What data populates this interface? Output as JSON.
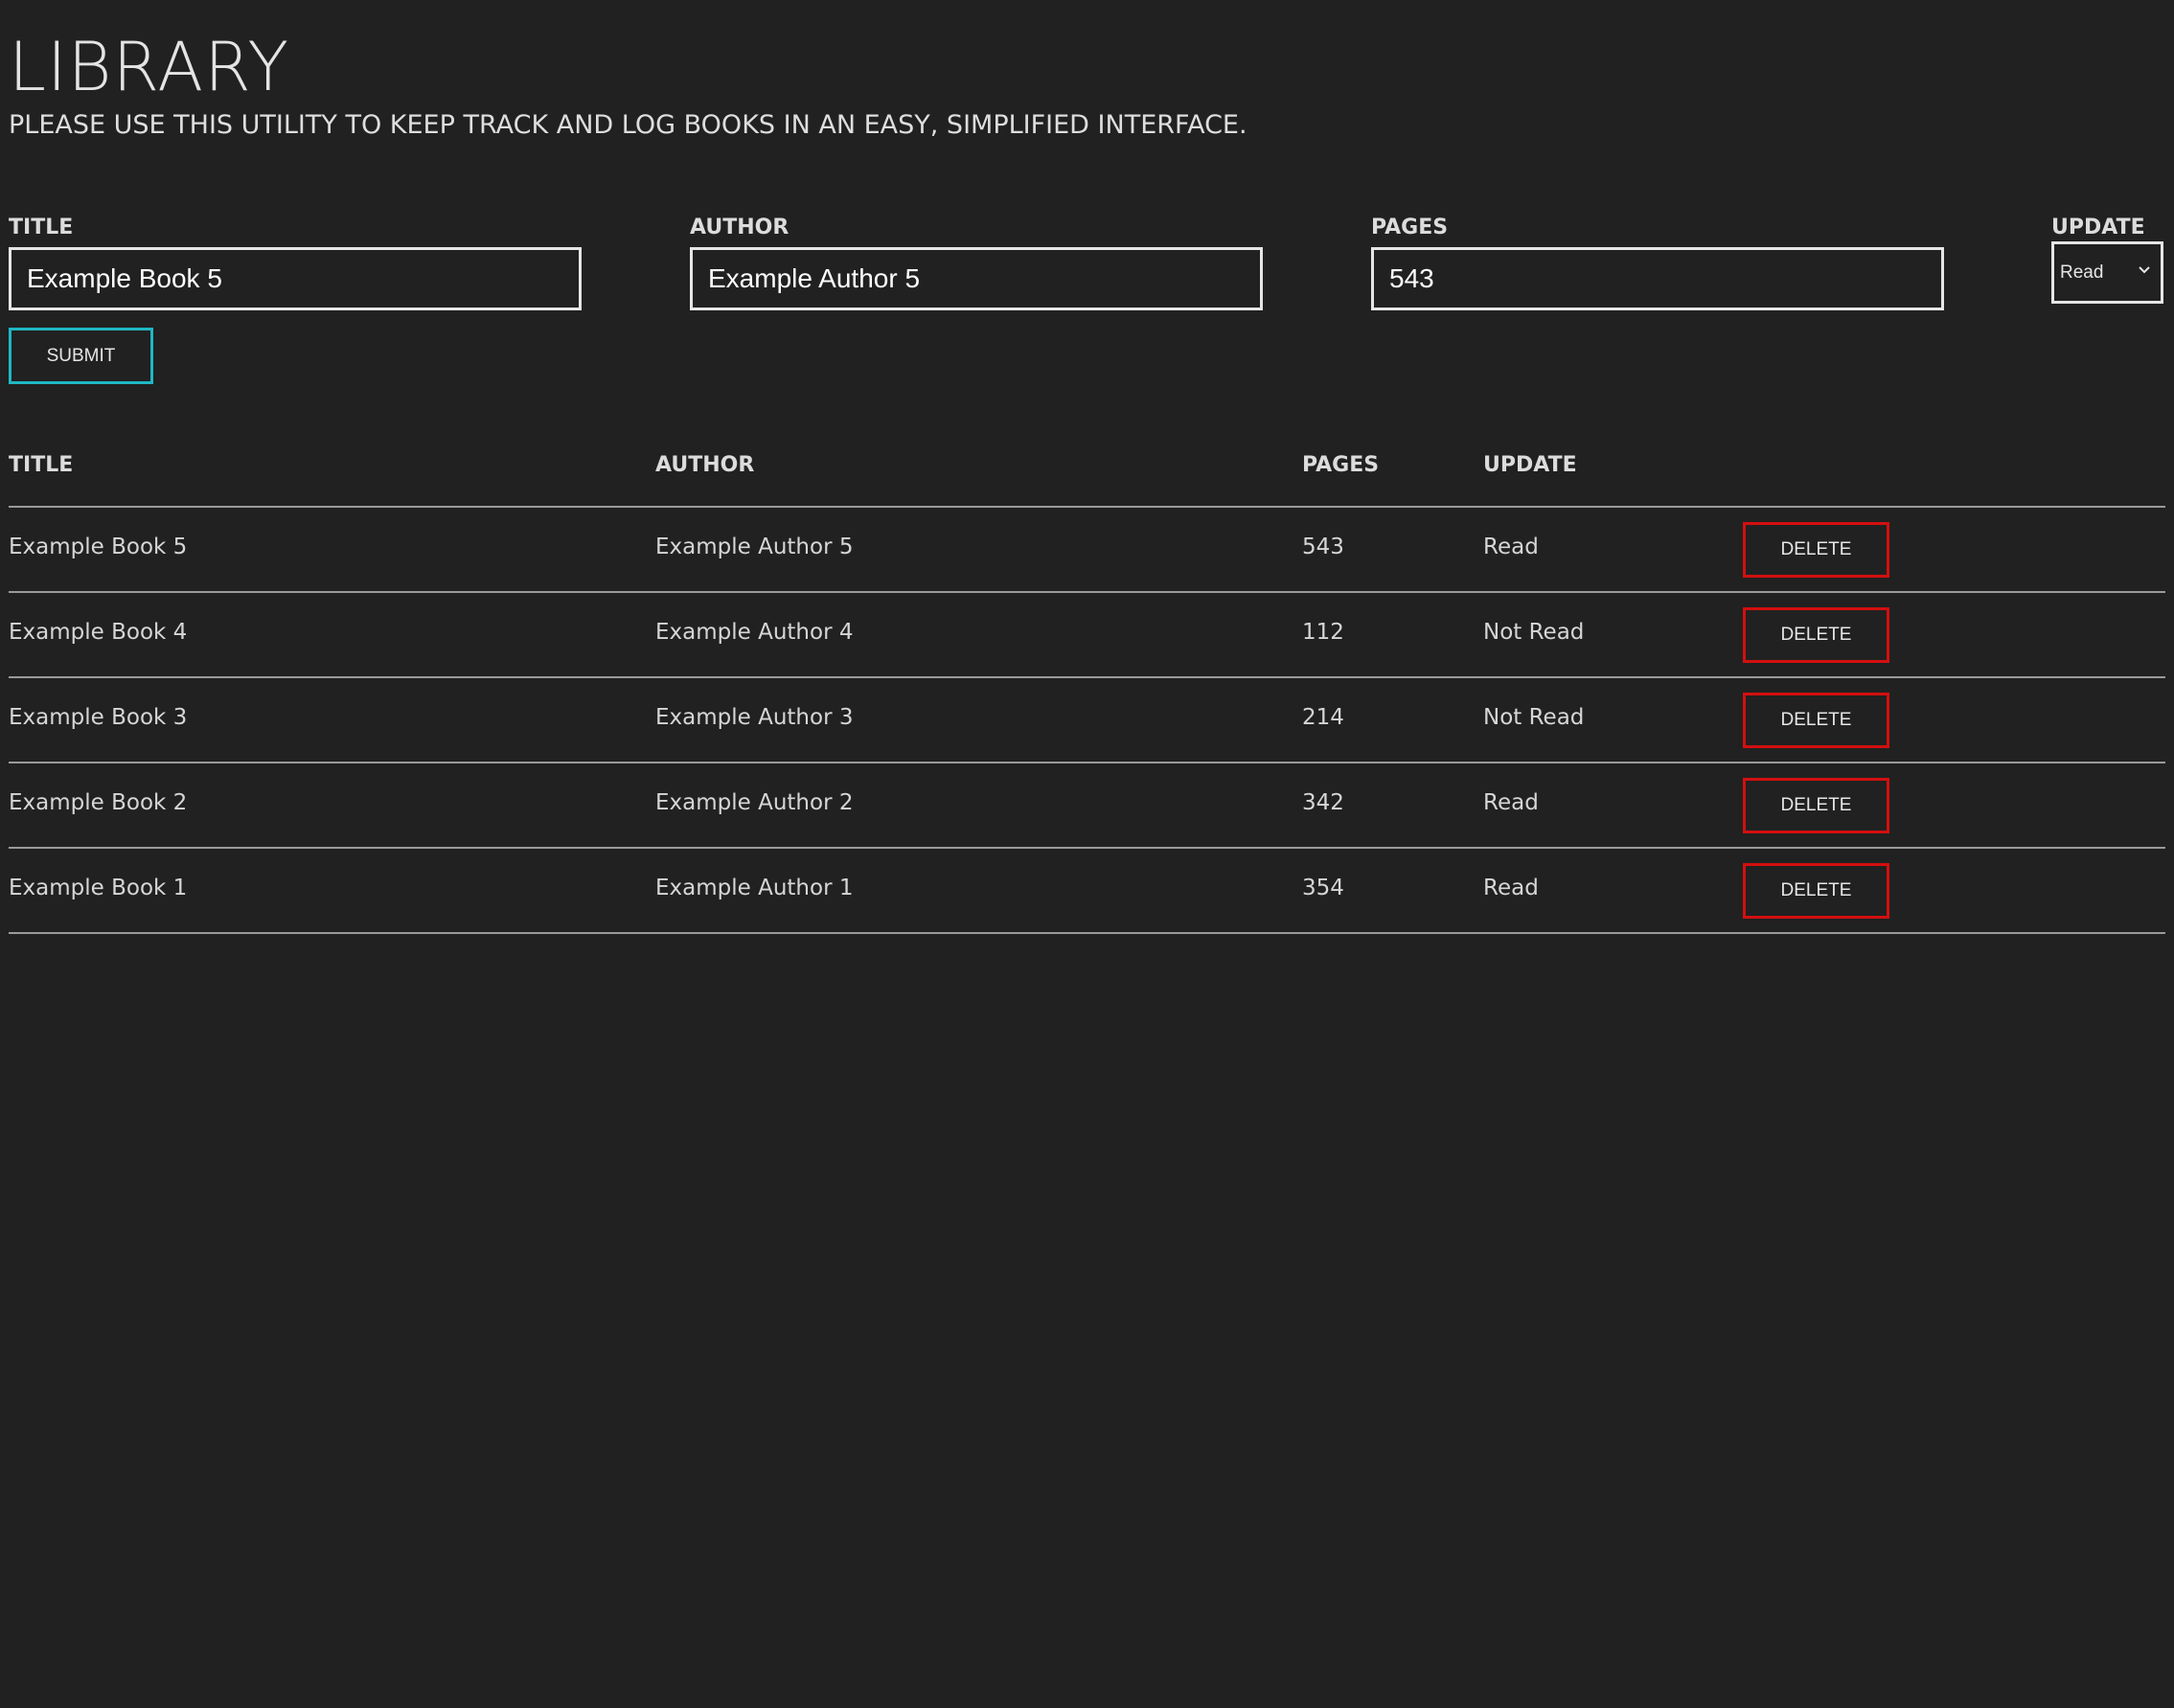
{
  "header": {
    "title": "LIBRARY",
    "subtitle": "PLEASE USE THIS UTILITY TO KEEP TRACK AND LOG BOOKS IN AN EASY, SIMPLIFIED INTERFACE."
  },
  "form": {
    "title_label": "TITLE",
    "title_value": "Example Book 5",
    "author_label": "AUTHOR",
    "author_value": "Example Author 5",
    "pages_label": "PAGES",
    "pages_value": "543",
    "update_label": "UPDATE",
    "update_value": "Read",
    "submit_label": "SUBMIT"
  },
  "table": {
    "headers": {
      "title": "TITLE",
      "author": "AUTHOR",
      "pages": "PAGES",
      "update": "UPDATE"
    },
    "delete_label": "DELETE",
    "rows": [
      {
        "title": "Example Book 5",
        "author": "Example Author 5",
        "pages": "543",
        "status": "Read"
      },
      {
        "title": "Example Book 4",
        "author": "Example Author 4",
        "pages": "112",
        "status": "Not Read"
      },
      {
        "title": "Example Book 3",
        "author": "Example Author 3",
        "pages": "214",
        "status": "Not Read"
      },
      {
        "title": "Example Book 2",
        "author": "Example Author 2",
        "pages": "342",
        "status": "Read"
      },
      {
        "title": "Example Book 1",
        "author": "Example Author 1",
        "pages": "354",
        "status": "Read"
      }
    ]
  },
  "colors": {
    "background": "#212121",
    "submit_border": "#1fb7c4",
    "delete_border": "#d40f0f"
  },
  "icons": {
    "select_chevron": "chevron-down-icon"
  }
}
